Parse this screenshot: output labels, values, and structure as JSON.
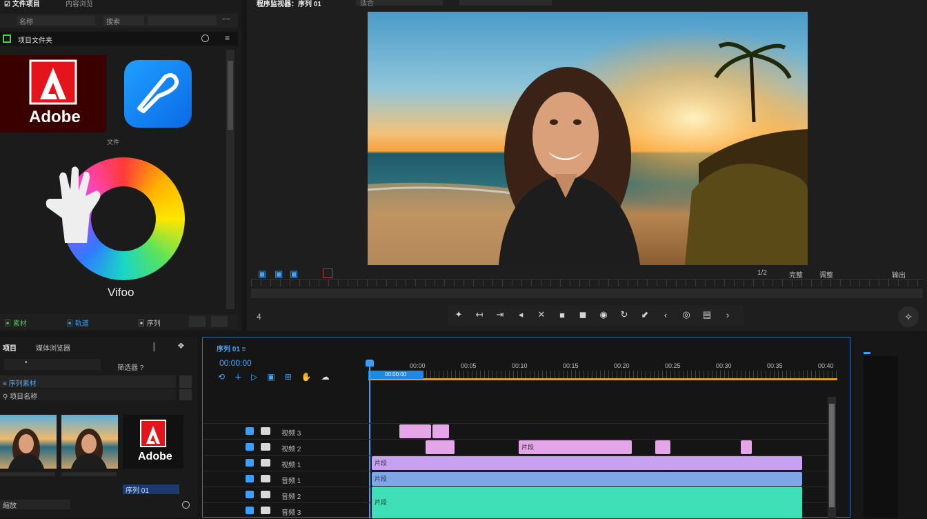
{
  "top_left": {
    "tab_title": "☑ 文件项目",
    "tab_secondary": "内容浏览",
    "bar_field_a": "名称",
    "bar_field_b": "搜索",
    "bar_field_c": "−−",
    "folder_label": "项目文件夹",
    "adobe_tile_label": "Adobe",
    "caption_small": "文件",
    "color_logo_label": "Vifoo"
  },
  "bottom_left_bar": {
    "items": [
      "▣ 素材",
      "▣ 轨道",
      "▣ 序列"
    ]
  },
  "program_header": {
    "title": "程序监视器：序列 01",
    "field": "适合"
  },
  "monitor_controls": {
    "left_labels": [
      "▣",
      "▣",
      "▣"
    ],
    "right_labels": [
      "1/2",
      "完整",
      "调整",
      "输出"
    ],
    "left_timecode": "4",
    "transport": [
      "✦",
      "↤",
      "⇥",
      "◂",
      "✕",
      "■",
      "◼",
      "◉",
      "↻",
      "⬋",
      "‹",
      "◎",
      "▤",
      "›"
    ]
  },
  "project_panel": {
    "title": "项目",
    "tab2": "媒体浏览器",
    "search_placeholder": "•",
    "filter_label": "筛选器 ?",
    "row1": "≡ 序列素材",
    "row2": "⚲ 项目名称",
    "thumb_labels": [
      "",
      "",
      "Adobe"
    ],
    "thumb_selected": "序列 01",
    "footer": "缩放"
  },
  "timeline": {
    "title": "序列 01 ≡",
    "timecode": "00:00:00",
    "ruler_ticks": [
      "00:00",
      "00:05",
      "00:10",
      "00:15",
      "00:20",
      "00:25",
      "00:30",
      "00:35",
      "00:40"
    ],
    "playhead_label": "00:00:00",
    "tracks": [
      {
        "name": "V3",
        "label": "视频 3"
      },
      {
        "name": "V2",
        "label": "视频 2"
      },
      {
        "name": "V1",
        "label": "视频 1"
      },
      {
        "name": "A1",
        "label": "音频 1"
      },
      {
        "name": "A2",
        "label": "音频 2"
      },
      {
        "name": "A3",
        "label": "音频 3"
      }
    ],
    "clip_label": "片段"
  },
  "colors": {
    "accent": "#1e88e5",
    "clip_pink": "#e4a6e8",
    "clip_violet": "#c8a2f0",
    "clip_blue": "#7fa6e6",
    "clip_teal": "#3fe0b8",
    "playhead": "#3aa0ff"
  }
}
